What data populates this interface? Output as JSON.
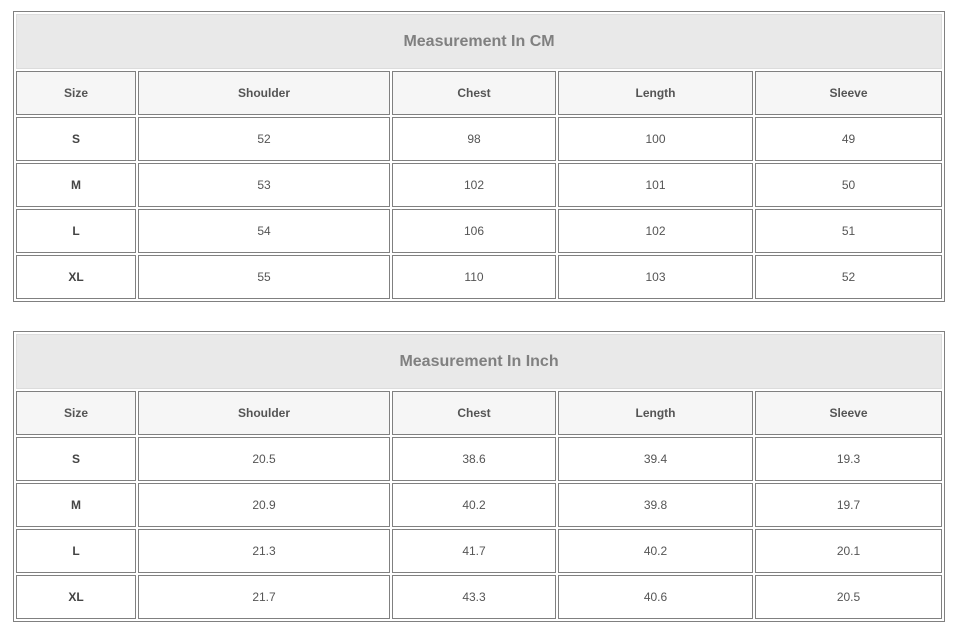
{
  "tables": [
    {
      "title": "Measurement In CM",
      "headers": [
        "Size",
        "Shoulder",
        "Chest",
        "Length",
        "Sleeve"
      ],
      "rows": [
        [
          "S",
          "52",
          "98",
          "100",
          "49"
        ],
        [
          "M",
          "53",
          "102",
          "101",
          "50"
        ],
        [
          "L",
          "54",
          "106",
          "102",
          "51"
        ],
        [
          "XL",
          "55",
          "110",
          "103",
          "52"
        ]
      ]
    },
    {
      "title": "Measurement In Inch",
      "headers": [
        "Size",
        "Shoulder",
        "Chest",
        "Length",
        "Sleeve"
      ],
      "rows": [
        [
          "S",
          "20.5",
          "38.6",
          "39.4",
          "19.3"
        ],
        [
          "M",
          "20.9",
          "40.2",
          "39.8",
          "19.7"
        ],
        [
          "L",
          "21.3",
          "41.7",
          "40.2",
          "20.1"
        ],
        [
          "XL",
          "21.7",
          "43.3",
          "40.6",
          "20.5"
        ]
      ]
    }
  ]
}
